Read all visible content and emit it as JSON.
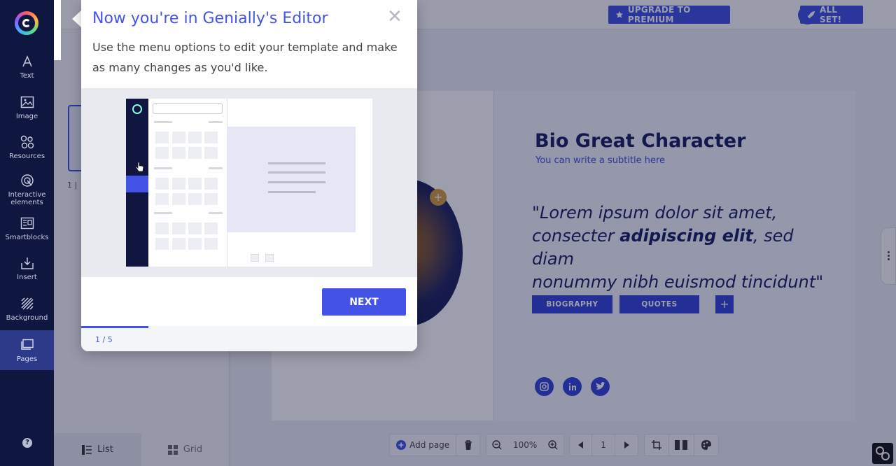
{
  "sidebar": {
    "items": [
      {
        "label": "Text"
      },
      {
        "label": "Image"
      },
      {
        "label": "Resources"
      },
      {
        "label": "Interactive elements"
      },
      {
        "label": "Smartblocks"
      },
      {
        "label": "Insert"
      },
      {
        "label": "Background"
      },
      {
        "label": "Pages"
      }
    ],
    "help": "?"
  },
  "topbar": {
    "upgrade_label": "UPGRADE TO PREMIUM",
    "all_set_label": "ALL SET!"
  },
  "pages_panel": {
    "page_number": "1 |",
    "list_tab": "List",
    "grid_tab": "Grid"
  },
  "canvas": {
    "title": "Bio Great Character",
    "subtitle": "You can write a subtitle here",
    "quote_1": "\"Lorem ipsum dolor sit amet,",
    "quote_2a": "consecter ",
    "quote_2b": "adipiscing elit",
    "quote_2c": ", sed diam",
    "quote_3": "nonummy nibh euismod tincidunt\"",
    "biography_btn": "BIOGRAPHY",
    "quotes_btn": "QUOTES",
    "plus": "+",
    "social": [
      "instagram",
      "linkedin",
      "twitter"
    ]
  },
  "bottom_toolbar": {
    "add_page": "Add page",
    "zoom": "100%",
    "page": "1"
  },
  "popup": {
    "title": "Now you're in Genially's Editor",
    "close": "✕",
    "description": "Use the menu options to edit your template and make as many changes as you'd like.",
    "next": "NEXT",
    "step": "1 / 5",
    "progress": 0.2
  },
  "colors": {
    "accent": "#4353e6",
    "sidebar_bg": "#0f1640",
    "title": "#141a5e"
  }
}
